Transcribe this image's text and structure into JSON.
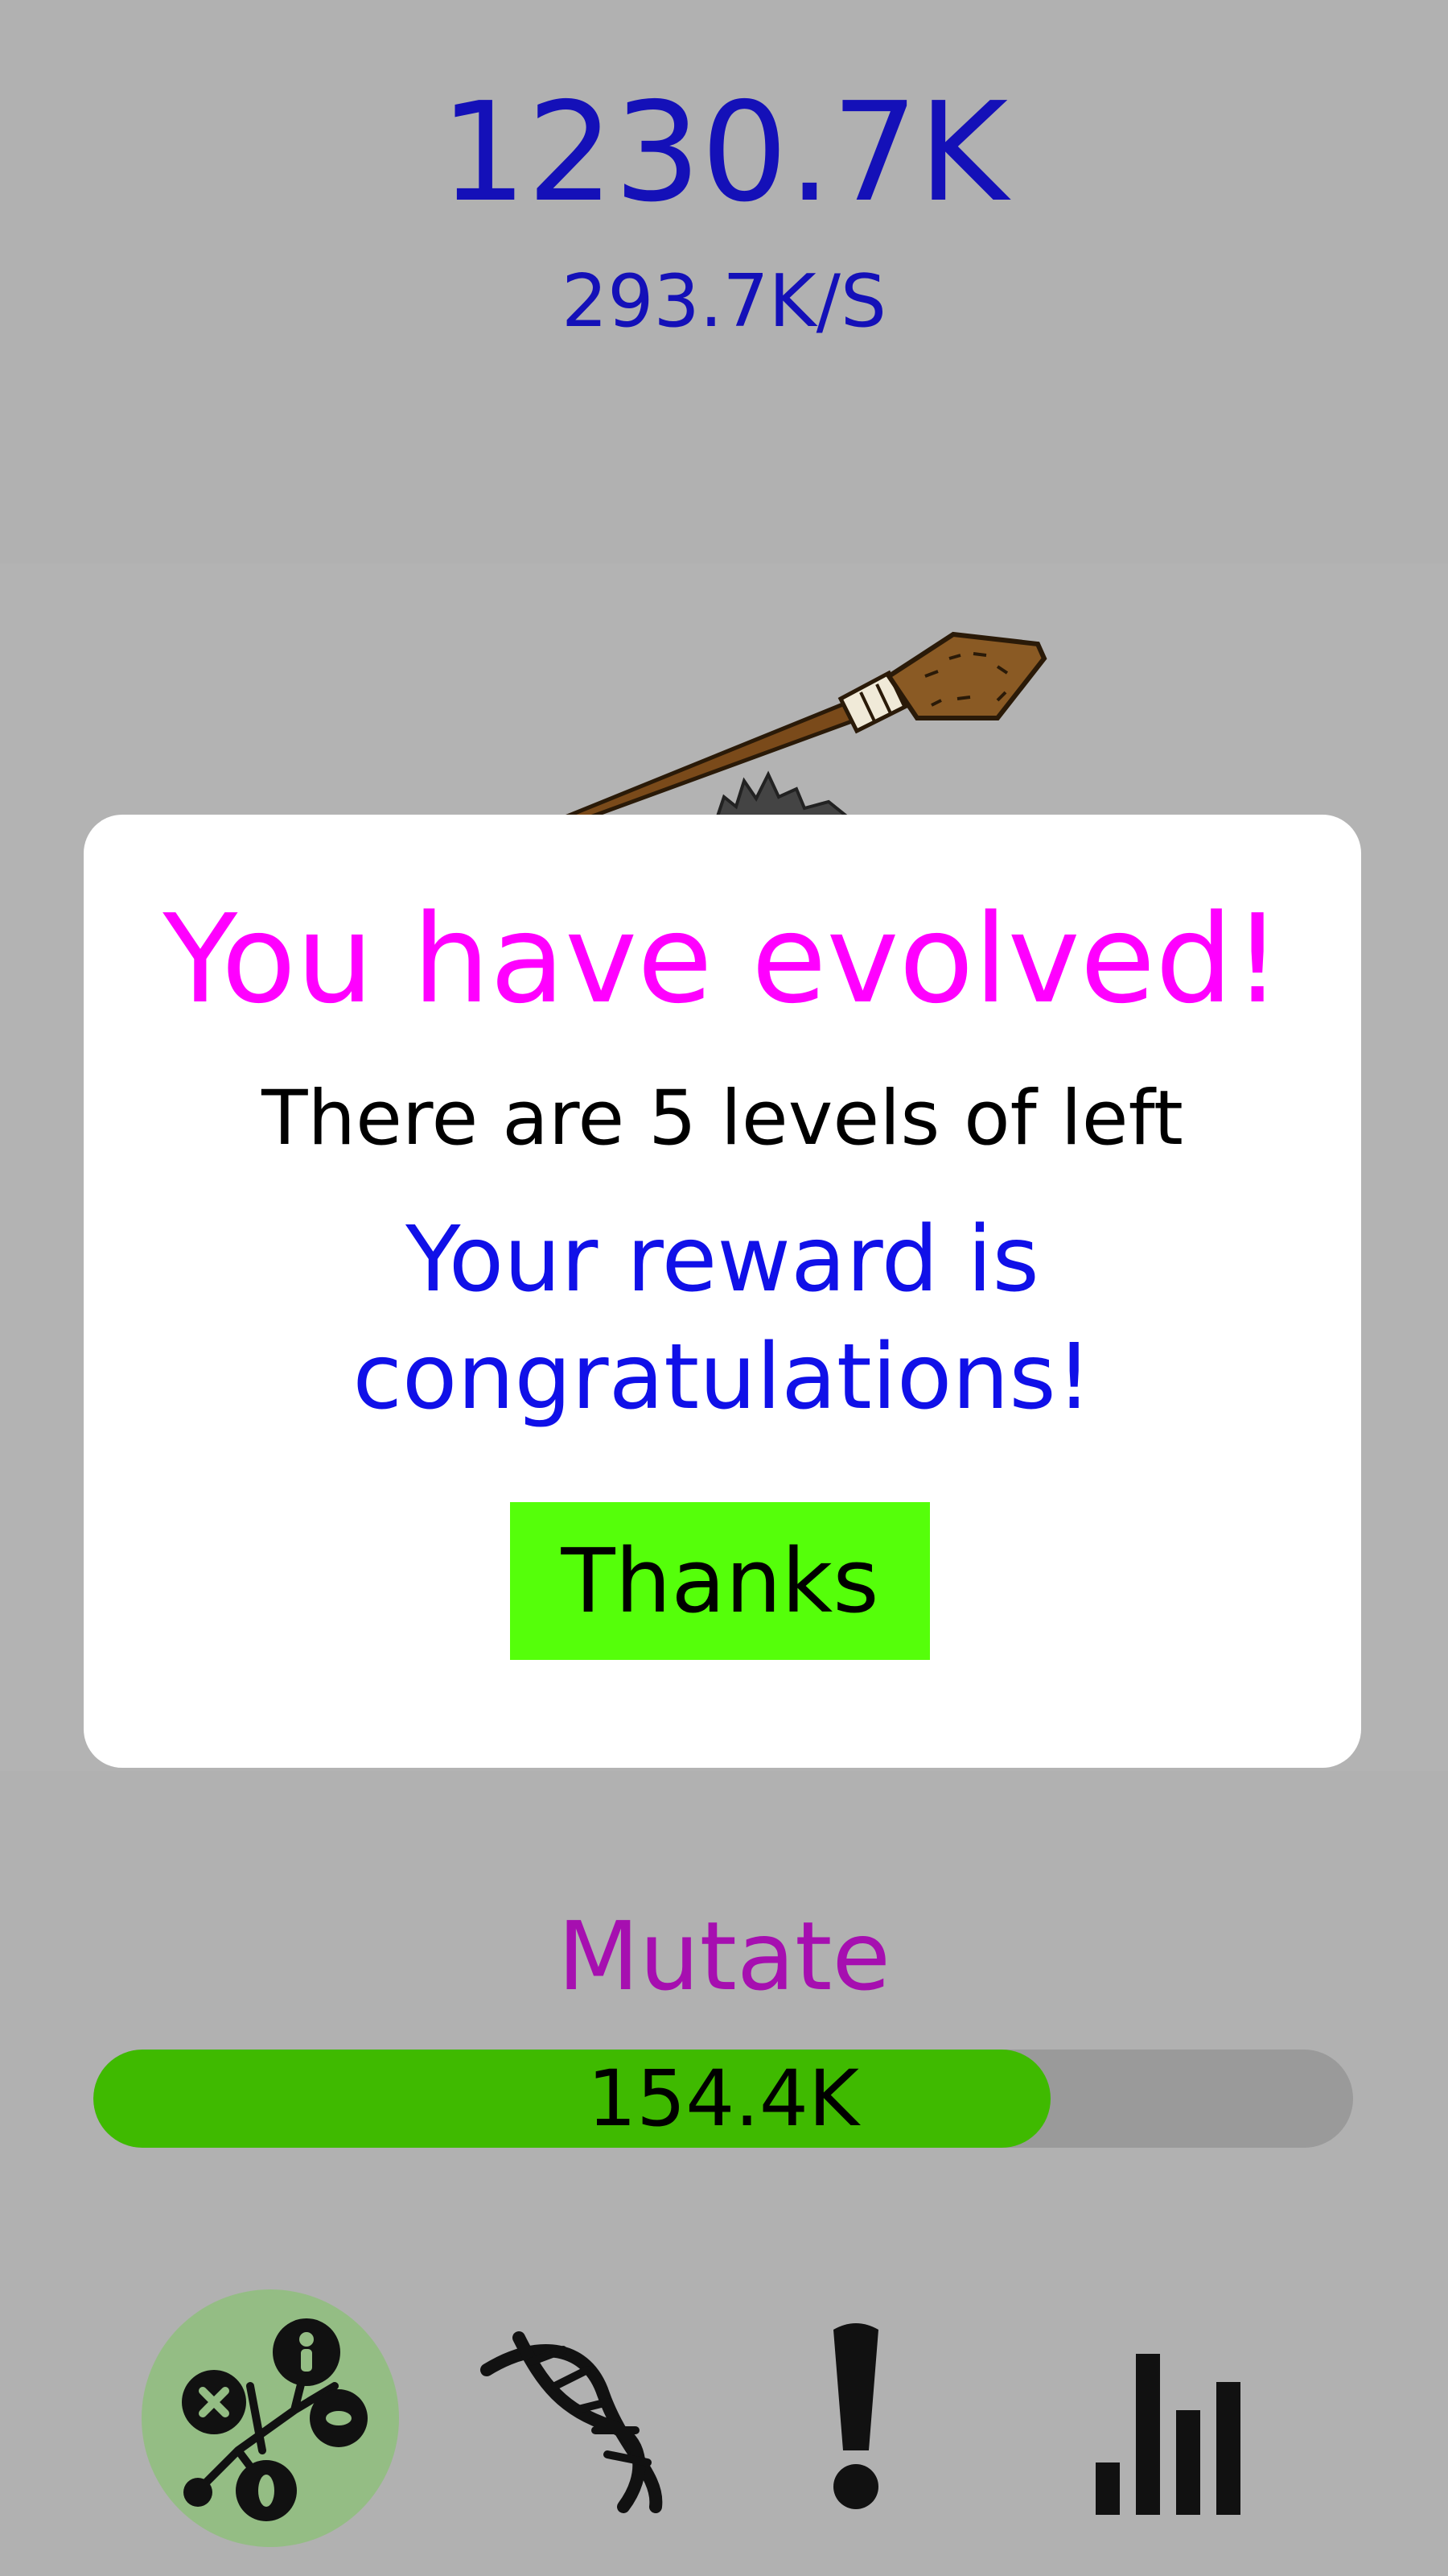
{
  "header": {
    "score": "1230.7K",
    "rate": "293.7K/S"
  },
  "dialog": {
    "title": "You have evolved!",
    "subtitle": "There are 5 levels of left",
    "reward": "Your reward is congratulations!",
    "button_label": "Thanks"
  },
  "mutate": {
    "label": "Mutate",
    "progress_value": "154.4K",
    "progress_fraction": 0.76
  },
  "nav": {
    "items": [
      {
        "name": "evolution-tree-icon",
        "active": true
      },
      {
        "name": "dna-icon",
        "active": false
      },
      {
        "name": "exclamation-icon",
        "active": false
      },
      {
        "name": "bar-chart-icon",
        "active": false
      }
    ]
  },
  "colors": {
    "background": "#b1b1b1",
    "score": "#1410b8",
    "title": "#ff00ff",
    "reward": "#1010e8",
    "button": "#55ff0a",
    "mutate": "#a60fb0",
    "progress_fill": "#3fba00",
    "progress_track": "#9a9a9a",
    "nav_active": "#94bd84"
  }
}
